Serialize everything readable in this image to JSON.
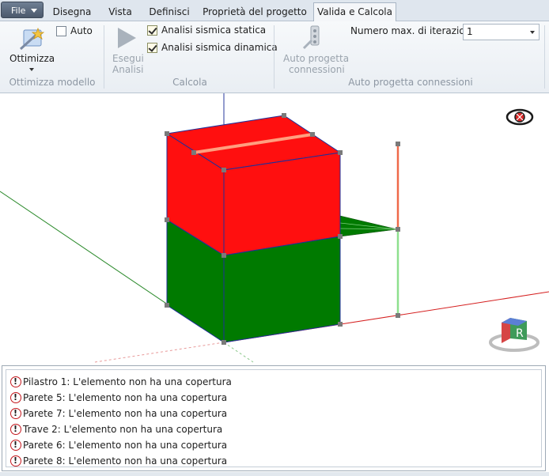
{
  "menu": {
    "file_label": "File",
    "tabs": [
      {
        "label": "Disegna",
        "active": false
      },
      {
        "label": "Vista",
        "active": false
      },
      {
        "label": "Definisci",
        "active": false
      },
      {
        "label": "Proprietà del progetto",
        "active": false
      },
      {
        "label": "Valida e Calcola",
        "active": true
      }
    ]
  },
  "ribbon": {
    "ottimizza_group": {
      "button_label": "Ottimizza",
      "auto_label": "Auto",
      "auto_checked": false,
      "group_label": "Ottimizza modello"
    },
    "calcola_group": {
      "run_label_line1": "Esegui",
      "run_label_line2": "Analisi",
      "static_label": "Analisi sismica statica",
      "static_checked": true,
      "dynamic_label": "Analisi sismica dinamica",
      "dynamic_checked": true,
      "group_label": "Calcola"
    },
    "connections_group": {
      "button_line1": "Auto progetta",
      "button_line2": "connessioni",
      "iterations_label": "Numero max. di iterazioni",
      "iterations_value": "1",
      "group_label": "Auto progetta connessioni"
    }
  },
  "viewport": {
    "icons": [
      "visibility-eye-icon",
      "view-cube-icon"
    ],
    "view_cube_face": "R",
    "colors": {
      "upper_block": "#ff0f0f",
      "lower_block": "#007a00",
      "edge": "#1f2f9a",
      "x_axis": "#d52020",
      "y_axis": "#2b8a2b",
      "z_axis": "#2a3a9c"
    }
  },
  "messages": [
    {
      "text": "Pilastro 1: L'elemento non ha una copertura"
    },
    {
      "text": "Parete 5: L'elemento non ha una copertura"
    },
    {
      "text": "Parete 7: L'elemento non ha una copertura"
    },
    {
      "text": "Trave 2: L'elemento non ha una copertura"
    },
    {
      "text": "Parete 6: L'elemento non ha una copertura"
    },
    {
      "text": "Parete 8: L'elemento non ha una copertura"
    }
  ]
}
